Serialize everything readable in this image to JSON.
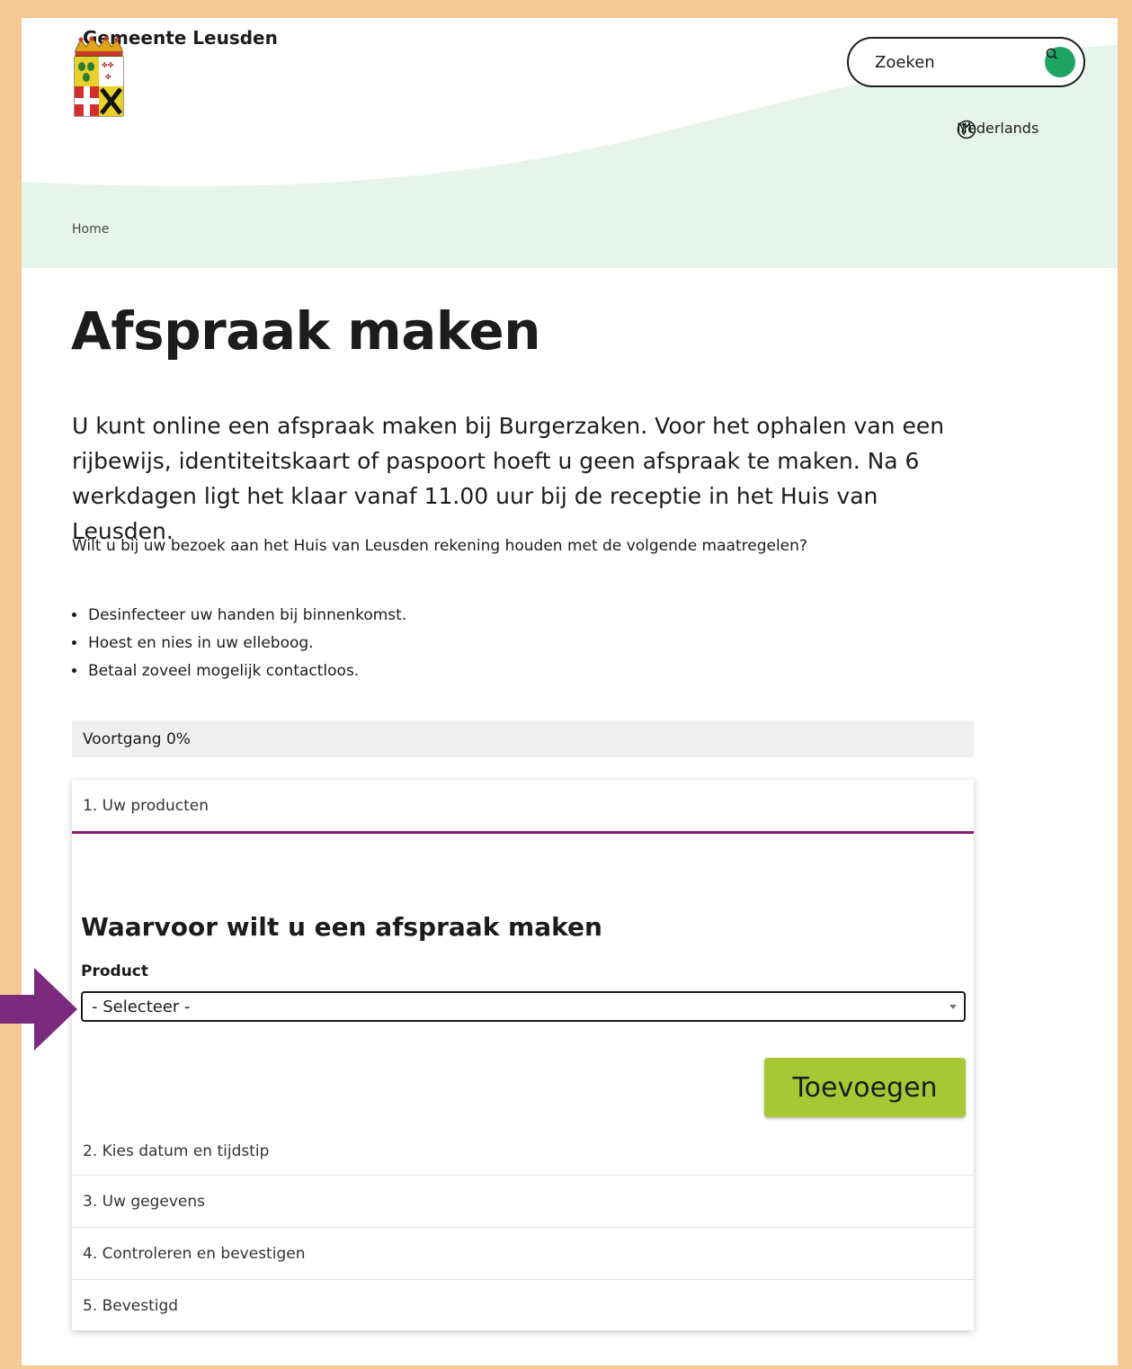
{
  "header": {
    "site_name": "Gemeente Leusden",
    "search_placeholder": "Zoeken",
    "language": "Nederlands"
  },
  "breadcrumb": {
    "home": "Home"
  },
  "page": {
    "title": "Afspraak maken",
    "intro": "U kunt online een afspraak maken bij Burgerzaken. Voor het ophalen van een rijbewijs, identiteitskaart of paspoort hoeft u geen afspraak te maken. Na 6 werkdagen ligt het klaar vanaf 11.00 uur bij de receptie in het Huis van Leusden.",
    "note": "Wilt u bij uw bezoek aan het Huis van Leusden rekening houden met de volgende maatregelen?",
    "measures": [
      "Desinfecteer uw handen bij binnenkomst.",
      "Hoest en nies in uw elleboog.",
      "Betaal zoveel mogelijk contactloos."
    ]
  },
  "progress": {
    "label": "Voortgang 0%",
    "value": 0
  },
  "steps": {
    "active": "1. Uw producten",
    "form_title": "Waarvoor wilt u een afspraak maken",
    "product_label": "Product",
    "product_selected": "- Selecteer -",
    "add_button": "Toevoegen",
    "others": [
      "2. Kies datum en tijdstip",
      "3. Uw gegevens",
      "4. Controleren en bevestigen",
      "5. Bevestigd"
    ]
  },
  "colors": {
    "border_frame": "#f4c993",
    "header_wave": "#e6f5ec",
    "search_button": "#1fa463",
    "accent_purple": "#8a1a73",
    "add_button": "#a5c935",
    "progress_bg": "#efefef"
  }
}
